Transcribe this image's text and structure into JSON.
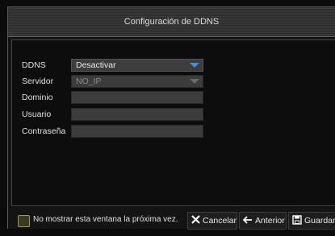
{
  "dialog": {
    "title": "Configuración de DDNS"
  },
  "form": {
    "ddns": {
      "label": "DDNS",
      "value": "Desactivar"
    },
    "server": {
      "label": "Servidor",
      "value": "NO_IP"
    },
    "domain": {
      "label": "Dominio",
      "value": ""
    },
    "user": {
      "label": "Usuario",
      "value": ""
    },
    "password": {
      "label": "Contraseña",
      "value": ""
    }
  },
  "footer": {
    "checkbox_label": "No mostrar esta ventana la próxima vez.",
    "checkbox_checked": false,
    "cancel_label": "Cancelar",
    "back_label": "Anterior",
    "save_label": "Guardar"
  },
  "colors": {
    "accent": "#3e8ee6",
    "background": "#0b0b0b"
  }
}
